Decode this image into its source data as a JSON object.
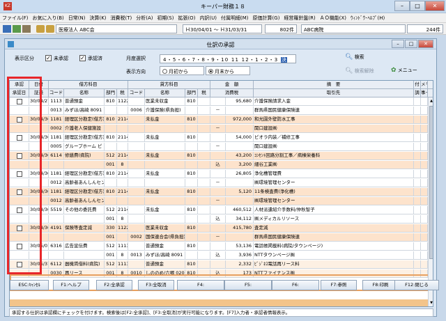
{
  "window": {
    "title": "キーパー財務１８",
    "app_icon": "KZ"
  },
  "menu": [
    "ファイル(F)",
    "お気に入り(B)",
    "日常(N)",
    "決算(K)",
    "消費税(T)",
    "分析(A)",
    "初期(S)",
    "拡張(O)",
    "内訳(U)",
    "付属明細(M)",
    "原価計算(G)",
    "経営羅針盤(R)",
    "ＡＯ機能(X)",
    "ｳｨﾝﾄﾞｳ･ﾍﾙﾌﾟ(H)"
  ],
  "toolbar": {
    "company": "医療法人 ABC会",
    "period": "Ｈ30/04/01 ～ Ｈ31/03/31",
    "count1": "802件",
    "filter": "ABC病院",
    "count2": "244件"
  },
  "form": {
    "title": "仕訳の承認",
    "display_label": "表示区分",
    "unapproved": "未承認",
    "approved": "承認済",
    "month_label": "月度選択",
    "months": "4・5・6・7・8・9・10 11 12・1・2・3",
    "month_selected": "決",
    "direction_label": "表示方向",
    "dir_forward": "月初から",
    "dir_backward": "月末から",
    "search": "検索",
    "search_clear": "検索解除",
    "menu": "メニュー"
  },
  "headers": {
    "top": [
      "承認",
      "日付",
      "借方科目",
      "貸方科目",
      "金　額",
      "摘　要",
      "付",
      "メモ"
    ],
    "sub": [
      "承認日",
      "証憑",
      "コード",
      "名称",
      "部門",
      "税",
      "コード",
      "名称",
      "部門",
      "税",
      "消費税",
      "取引先",
      "調",
      "事･代"
    ]
  },
  "rows": [
    {
      "date": "30/04/27",
      "dcode": "1113",
      "dname": "普通預金",
      "ddept": "810",
      "dtax": "1122",
      "ccode": "",
      "cname": "医業未収金",
      "cdept": "810",
      "ctax": "",
      "mark": "",
      "amount": "95,680",
      "memo": "介護保険請求入金"
    },
    {
      "date": "",
      "dcode": "0013",
      "dname": "みずほ/高崎 8091",
      "ddept": "",
      "dtax": "",
      "ccode": "0006",
      "cname": "介護保険(県負担)",
      "cdept": "",
      "ctax": "",
      "mark": "－",
      "amount": "",
      "memo": "群馬県国民健康保険連"
    },
    {
      "date": "30/04/30",
      "dcode": "1181",
      "dname": "経理区分勘定(借方)",
      "ddept": "810",
      "dtax": "2114",
      "ccode": "",
      "cname": "未払金",
      "cdept": "810",
      "ctax": "",
      "mark": "",
      "amount": "972,000",
      "memo": "和光園外壁防水工事"
    },
    {
      "date": "",
      "dcode": "0002",
      "dname": "介護老人保健施設",
      "ddept": "",
      "dtax": "",
      "ccode": "",
      "cname": "",
      "cdept": "",
      "ctax": "",
      "mark": "－",
      "amount": "",
      "memo": "関口建設㈱"
    },
    {
      "date": "30/04/30",
      "dcode": "1181",
      "dname": "経理区分勘定(借方)",
      "ddept": "810",
      "dtax": "2114",
      "ccode": "",
      "cname": "未払金",
      "cdept": "810",
      "ctax": "",
      "mark": "",
      "amount": "54,000",
      "memo": "ピオラ内装／補修工事"
    },
    {
      "date": "",
      "dcode": "0005",
      "dname": "グループホーム ピ",
      "ddept": "",
      "dtax": "",
      "ccode": "",
      "cname": "",
      "cdept": "",
      "ctax": "",
      "mark": "－",
      "amount": "",
      "memo": "関口建設㈱"
    },
    {
      "date": "30/04/30",
      "dcode": "6114",
      "dname": "修繕費(病院)",
      "ddept": "512",
      "dtax": "2114",
      "ccode": "",
      "cname": "未払金",
      "cdept": "810",
      "ctax": "",
      "mark": "",
      "amount": "43,200",
      "memo": "ｺﾝｾﾝﾄ回路分割工事／病棟栄養科"
    },
    {
      "date": "",
      "dcode": "",
      "dname": "",
      "ddept": "001",
      "dtax": "8",
      "ccode": "",
      "cname": "",
      "cdept": "",
      "ctax": "",
      "mark": "込",
      "amount": "3,200",
      "memo": "細谷工業㈱"
    },
    {
      "date": "30/04/30",
      "dcode": "1181",
      "dname": "経理区分勘定(借方)",
      "ddept": "810",
      "dtax": "2114",
      "ccode": "",
      "cname": "未払金",
      "cdept": "810",
      "ctax": "",
      "mark": "",
      "amount": "26,805",
      "memo": "浄化槽管理費"
    },
    {
      "date": "",
      "dcode": "0012",
      "dname": "高齢者あんしんセン",
      "ddept": "",
      "dtax": "",
      "ccode": "",
      "cname": "",
      "cdept": "",
      "ctax": "",
      "mark": "－",
      "amount": "",
      "memo": "㈱環境管理センター"
    },
    {
      "date": "30/04/30",
      "dcode": "1181",
      "dname": "経理区分勘定(借方)",
      "ddept": "810",
      "dtax": "2114",
      "ccode": "",
      "cname": "未払金",
      "cdept": "810",
      "ctax": "",
      "mark": "",
      "amount": "5,120",
      "memo": "11条検査費(浄化槽)"
    },
    {
      "date": "",
      "dcode": "0012",
      "dname": "高齢者あんしんセン",
      "ddept": "",
      "dtax": "",
      "ccode": "",
      "cname": "",
      "cdept": "",
      "ctax": "",
      "mark": "－",
      "amount": "",
      "memo": "㈱環境管理センター"
    },
    {
      "date": "30/04/30",
      "dcode": "5519",
      "dname": "その他の委託費",
      "ddept": "512",
      "dtax": "2114",
      "ccode": "",
      "cname": "未払金",
      "cdept": "810",
      "ctax": "",
      "mark": "",
      "amount": "460,512",
      "memo": "人材派遣紹介手数料/仲秋智子"
    },
    {
      "date": "",
      "dcode": "",
      "dname": "",
      "ddept": "001",
      "dtax": "8",
      "ccode": "",
      "cname": "",
      "cdept": "",
      "ctax": "",
      "mark": "込",
      "amount": "34,112",
      "memo": "㈱メディカルリソース"
    },
    {
      "date": "30/04/30",
      "dcode": "4191",
      "dname": "保険等査定減",
      "ddept": "330",
      "dtax": "1122",
      "ccode": "",
      "cname": "医業未収金",
      "cdept": "810",
      "ctax": "",
      "mark": "",
      "amount": "415,780",
      "memo": "査定減"
    },
    {
      "date": "",
      "dcode": "",
      "dname": "",
      "ddept": "001",
      "dtax": "",
      "ccode": "0002",
      "cname": "国保連合会(県負担)",
      "cdept": "",
      "ctax": "",
      "mark": "－",
      "amount": "",
      "memo": "群馬県国民健康保険連"
    },
    {
      "date": "30/05/01",
      "dcode": "6316",
      "dname": "広告宣伝費",
      "ddept": "512",
      "dtax": "1113",
      "ccode": "",
      "cname": "普通預金",
      "cdept": "810",
      "ctax": "",
      "mark": "",
      "amount": "53,136",
      "memo": "電話帳掲載料(病院/タウンページ)"
    },
    {
      "date": "",
      "dcode": "",
      "dname": "",
      "ddept": "001",
      "dtax": "8",
      "ccode": "0013",
      "cname": "みずほ/高崎 8091",
      "cdept": "",
      "ctax": "",
      "mark": "込",
      "amount": "3,936",
      "memo": "NTTタウンページ㈱"
    },
    {
      "date": "30/05/31",
      "dcode": "6112",
      "dname": "器機賃借料(病院)",
      "ddept": "512",
      "dtax": "1113",
      "ccode": "",
      "cname": "普通預金",
      "cdept": "810",
      "ctax": "",
      "mark": "",
      "amount": "2,332",
      "memo": "ﾋﾞｼﾞﾈｽ電話再リース料"
    },
    {
      "date": "",
      "dcode": "0030",
      "dname": "再リース",
      "ddept": "001",
      "dtax": "8",
      "ccode": "0010",
      "cname": "しののめ/六郷 020",
      "cdept": "810",
      "ctax": "",
      "mark": "込",
      "amount": "173",
      "memo": "NTTファイナンス㈱"
    }
  ],
  "status_text": "承認する仕訳は承認欄にチェックを付けます。検索後は[F2:全承認]、[F3:全取消]が実行可能になります。[F7]入力者・承認者情報表示。",
  "fkeys": [
    "ESC:ｷｬﾝｾﾙ",
    "F1:ヘルプ",
    "F2:全承認",
    "F3:全取消",
    "F4:",
    "F5:",
    "F6:",
    "F7:参照",
    "F8:印刷",
    "F12:閉じる"
  ],
  "colors": {
    "row_alt": "#fde3cc",
    "highlight_red": "#e8262a",
    "select_orange": "#e8a060"
  }
}
